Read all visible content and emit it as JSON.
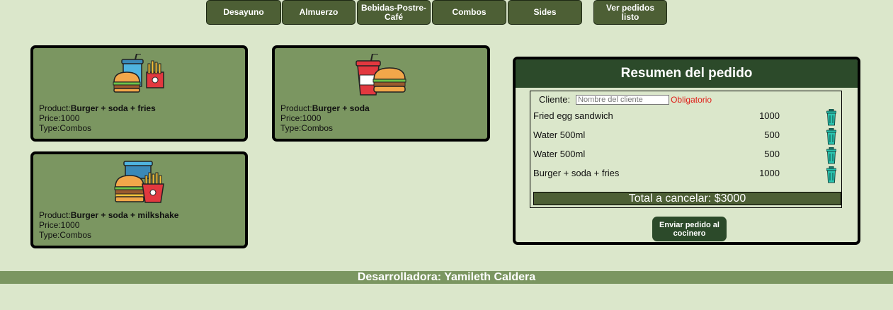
{
  "nav": {
    "buttons": [
      "Desayuno",
      "Almuerzo",
      "Bebidas-Postre-Café",
      "Combos",
      "Sides",
      "Ver pedidos listo"
    ]
  },
  "products": [
    {
      "label": "Product:",
      "name": "Burger + soda + fries",
      "price": "Price:1000",
      "type": "Type:Combos",
      "icon": "burger-soda-fries-icon"
    },
    {
      "label": "Product:",
      "name": "Burger + soda",
      "price": "Price:1000",
      "type": "Type:Combos",
      "icon": "burger-soda-icon"
    },
    {
      "label": "Product:",
      "name": "Burger + soda + milkshake",
      "price": "Price:1000",
      "type": "Type:Combos",
      "icon": "burger-milkshake-fries-icon"
    }
  ],
  "summary": {
    "title": "Resumen del pedido",
    "client_label": "Cliente:",
    "client_placeholder": "Nombre del cliente",
    "client_value": "",
    "required_text": "Obligatorio",
    "items": [
      {
        "name": "Fried egg sandwich",
        "price": "1000"
      },
      {
        "name": "Water 500ml",
        "price": "500"
      },
      {
        "name": "Water 500ml",
        "price": "500"
      },
      {
        "name": "Burger + soda + fries",
        "price": "1000"
      }
    ],
    "total": "Total a cancelar: $3000",
    "send_button": "Enviar pedido al cocinero"
  },
  "footer": {
    "text": "Desarrolladora: Yamileth Caldera"
  },
  "colors": {
    "background": "#dbe7cb",
    "nav_button": "#4d5f35",
    "card": "#7b9661",
    "header": "#2c4a2a",
    "required": "#e0201a",
    "trash": "#2bc4b0"
  }
}
